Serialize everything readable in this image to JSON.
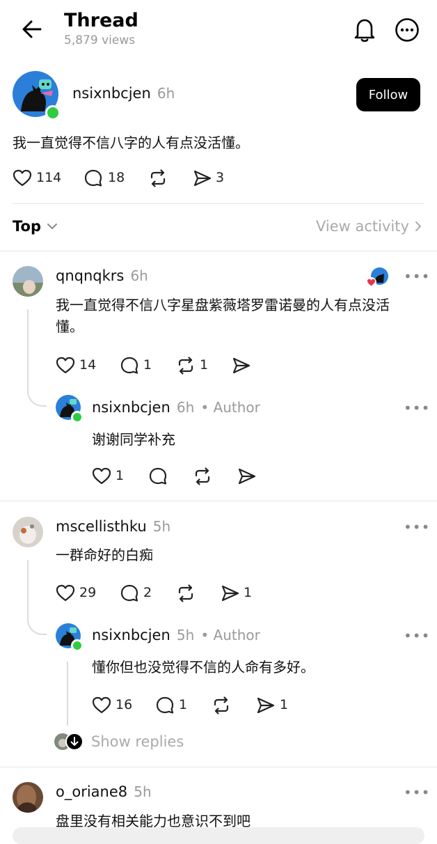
{
  "header": {
    "title": "Thread",
    "views": "5,879 views"
  },
  "post": {
    "username": "nsixnbcjen",
    "time": "6h",
    "follow_label": "Follow",
    "text": "我一直觉得不信八字的人有点没活懂。",
    "likes": "114",
    "comments": "18",
    "shares": "3"
  },
  "sort": {
    "label": "Top",
    "view_activity": "View activity"
  },
  "replies": [
    {
      "username": "qnqnqkrs",
      "time": "6h",
      "text_line1": "我一直觉得不信八字星盘紫薇塔罗雷诺曼的人有点没活",
      "text_line2": "懂。",
      "likes": "14",
      "comments": "1",
      "reposts": "1",
      "reply": {
        "username": "nsixnbcjen",
        "time": "6h",
        "author_tag": "• Author",
        "text": "谢谢同学补充",
        "likes": "1"
      }
    },
    {
      "username": "mscellisthku",
      "time": "5h",
      "text": "一群命好的白痴",
      "likes": "29",
      "comments": "2",
      "shares": "1",
      "reply": {
        "username": "nsixnbcjen",
        "time": "5h",
        "author_tag": "• Author",
        "text": "懂你但也没觉得不信的人命有多好。",
        "likes": "16",
        "comments": "1",
        "shares": "1"
      },
      "show_replies": "Show replies"
    },
    {
      "username": "o_oriane8",
      "time": "5h",
      "text": "盘里没有相关能力也意识不到吧"
    }
  ],
  "icons": {
    "back": "arrow-left-icon",
    "bell": "bell-icon",
    "more": "more-circle-icon",
    "like": "heart-icon",
    "comment": "comment-icon",
    "repost": "repost-icon",
    "share": "send-icon"
  },
  "colors": {
    "online": "#2ecc40",
    "follow_bg": "#000000",
    "heart_red": "#e8344e"
  }
}
